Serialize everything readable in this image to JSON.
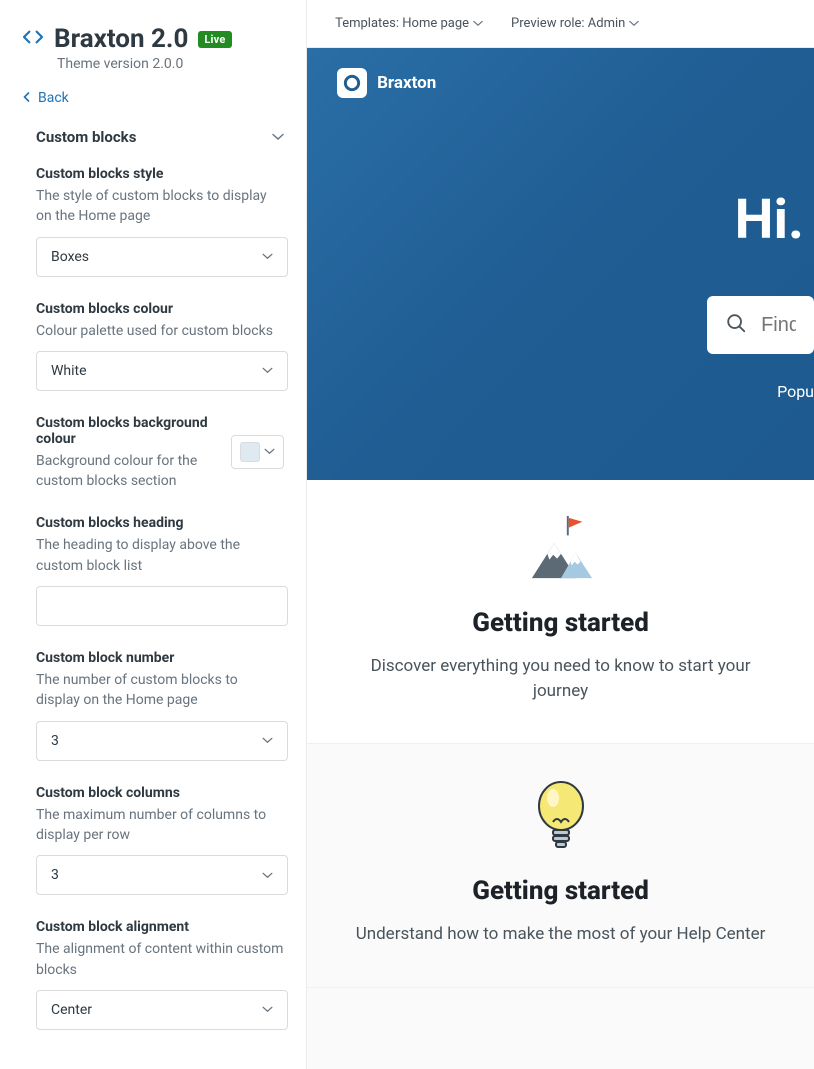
{
  "sidebar": {
    "title": "Braxton 2.0",
    "badge": "Live",
    "subtitle": "Theme version 2.0.0",
    "back": "Back",
    "section": "Custom blocks",
    "fields": {
      "style": {
        "label": "Custom blocks style",
        "desc": "The style of custom blocks to display on the Home page",
        "value": "Boxes"
      },
      "colour": {
        "label": "Custom blocks colour",
        "desc": "Colour palette used for custom blocks",
        "value": "White"
      },
      "bg": {
        "label": "Custom blocks background colour",
        "desc": "Background colour for the custom blocks section",
        "value": "#dfe9f0"
      },
      "heading": {
        "label": "Custom blocks heading",
        "desc": "The heading to display above the custom block list",
        "value": ""
      },
      "number": {
        "label": "Custom block number",
        "desc": "The number of custom blocks to display on the Home page",
        "value": "3"
      },
      "columns": {
        "label": "Custom block columns",
        "desc": "The maximum number of columns to display per row",
        "value": "3"
      },
      "alignment": {
        "label": "Custom block alignment",
        "desc": "The alignment of content within custom blocks",
        "value": "Center"
      }
    }
  },
  "topbar": {
    "templates": "Templates: Home page",
    "preview_role": "Preview role: Admin"
  },
  "hero": {
    "brand": "Braxton",
    "hi": "Hi.",
    "search_placeholder": "Find an",
    "popular": "Popu"
  },
  "cards": [
    {
      "title": "Getting started",
      "desc": "Discover everything you need to know to start your journey"
    },
    {
      "title": "Getting started",
      "desc": "Understand how to make the most of your Help Center"
    }
  ]
}
